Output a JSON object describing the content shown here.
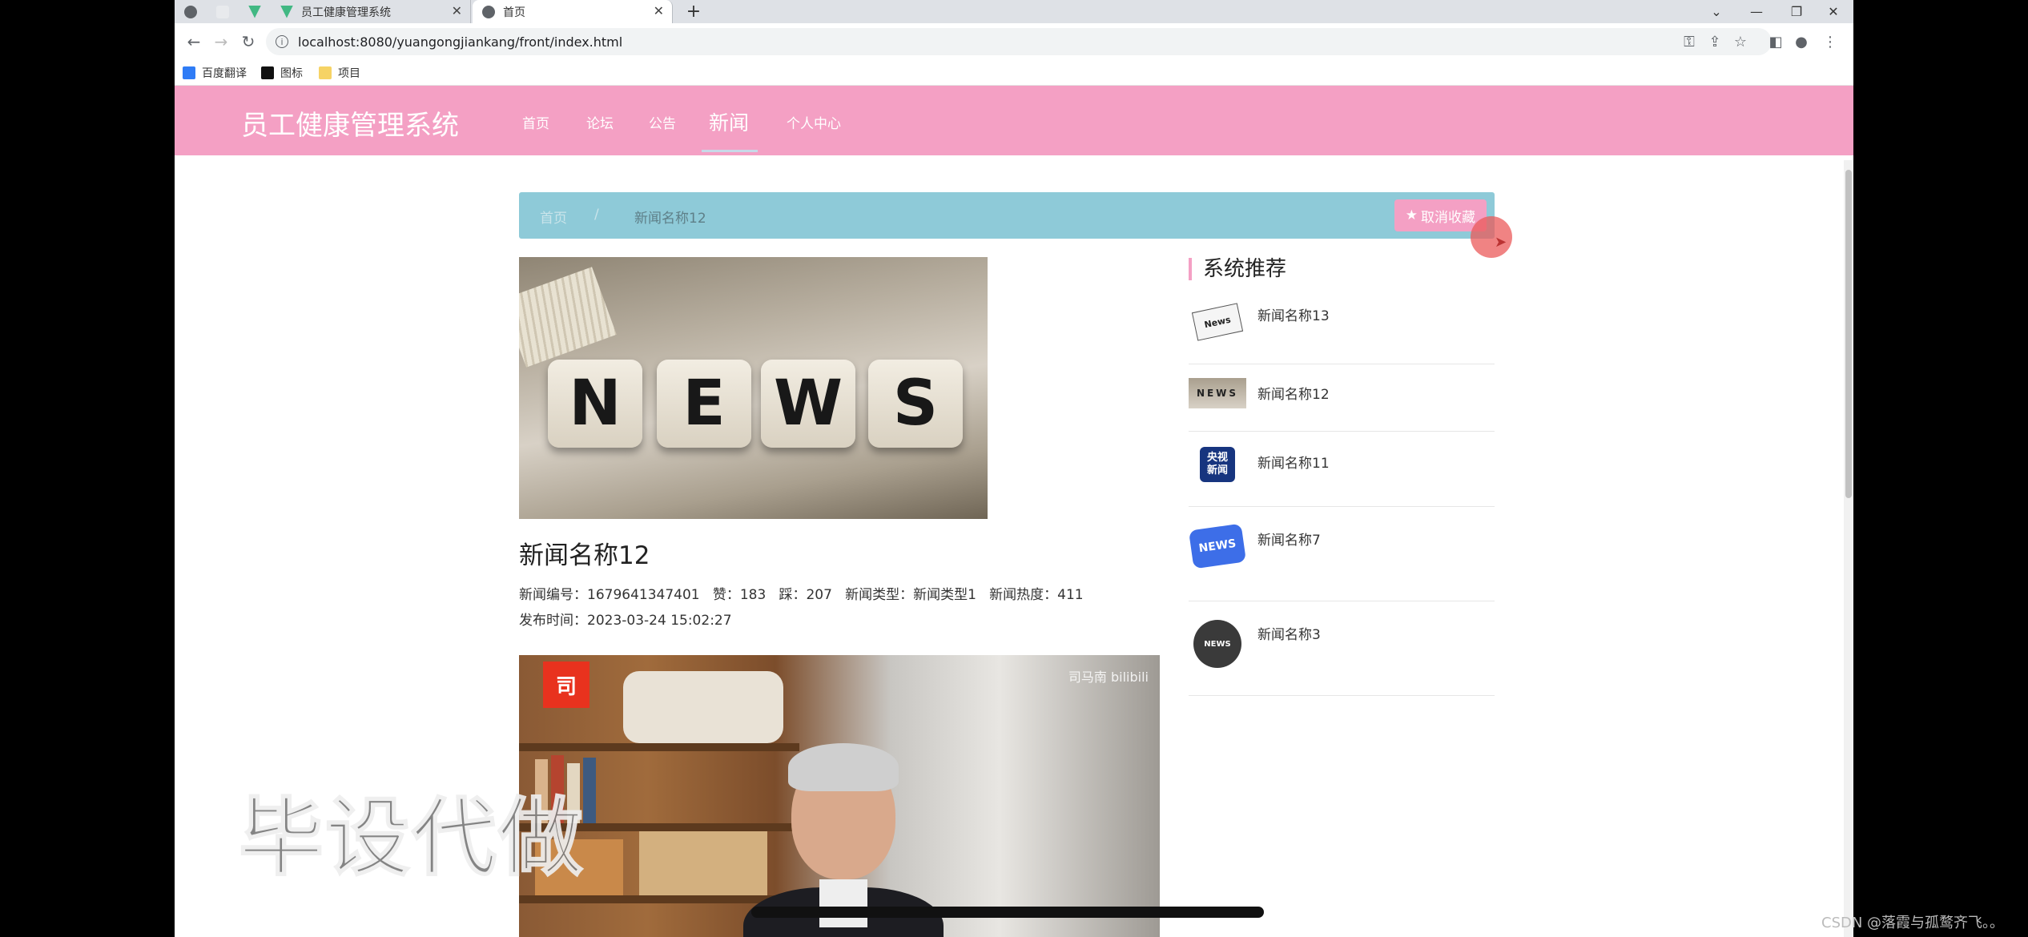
{
  "browser": {
    "tabs": [
      {
        "title": "员工健康管理系统",
        "active": false
      },
      {
        "title": "首页",
        "active": true
      }
    ],
    "new_tab_label": "+",
    "url": "localhost:8080/yuangongjiankang/front/index.html",
    "bookmarks": [
      "百度翻译",
      "图标",
      "项目"
    ]
  },
  "site": {
    "title": "员工健康管理系统",
    "nav": [
      {
        "label": "首页",
        "active": false
      },
      {
        "label": "论坛",
        "active": false
      },
      {
        "label": "公告",
        "active": false
      },
      {
        "label": "新闻",
        "active": true
      },
      {
        "label": "个人中心",
        "active": false
      }
    ],
    "accent_color": "#f4a0c4",
    "breadcrumb_color": "#8ecad8"
  },
  "breadcrumb": {
    "home": "首页",
    "separator": "/",
    "current": "新闻名称12",
    "favorite_button": "取消收藏"
  },
  "article": {
    "image_text": [
      "N",
      "E",
      "W",
      "S"
    ],
    "title": "新闻名称12",
    "meta_line1": "新闻编号：1679641347401   赞：183   踩：207   新闻类型：新闻类型1   新闻热度：411",
    "meta_line2": "发布时间：2023-03-24 15:02:27",
    "video": {
      "badge": "司",
      "watermark": "司马南 bilibili"
    }
  },
  "sidebar": {
    "heading": "系统推荐",
    "items": [
      {
        "title": "新闻名称13",
        "icon": "newspaper-icon"
      },
      {
        "title": "新闻名称12",
        "icon": "news-dice-icon"
      },
      {
        "title": "新闻名称11",
        "icon": "cctv-news-icon"
      },
      {
        "title": "新闻名称7",
        "icon": "news-megaphone-icon"
      },
      {
        "title": "新闻名称3",
        "icon": "news-globe-icon"
      }
    ]
  },
  "overlay": {
    "watermark_text": "毕设代做",
    "credit": "CSDN @落霞与孤鹜齐飞。。"
  }
}
